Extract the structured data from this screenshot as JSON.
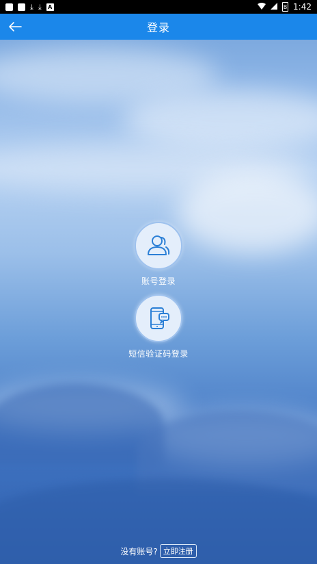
{
  "status_bar": {
    "time": "1:42",
    "battery_glyph": "B"
  },
  "header": {
    "title": "登录"
  },
  "login_options": [
    {
      "label": "账号登录",
      "icon": "user-icon"
    },
    {
      "label": "短信验证码登录",
      "icon": "phone-sms-icon"
    }
  ],
  "footer": {
    "prompt": "没有账号?",
    "register_label": "立即注册"
  },
  "colors": {
    "header_bg": "#1b87ea",
    "icon_stroke": "#2b7fd6"
  }
}
